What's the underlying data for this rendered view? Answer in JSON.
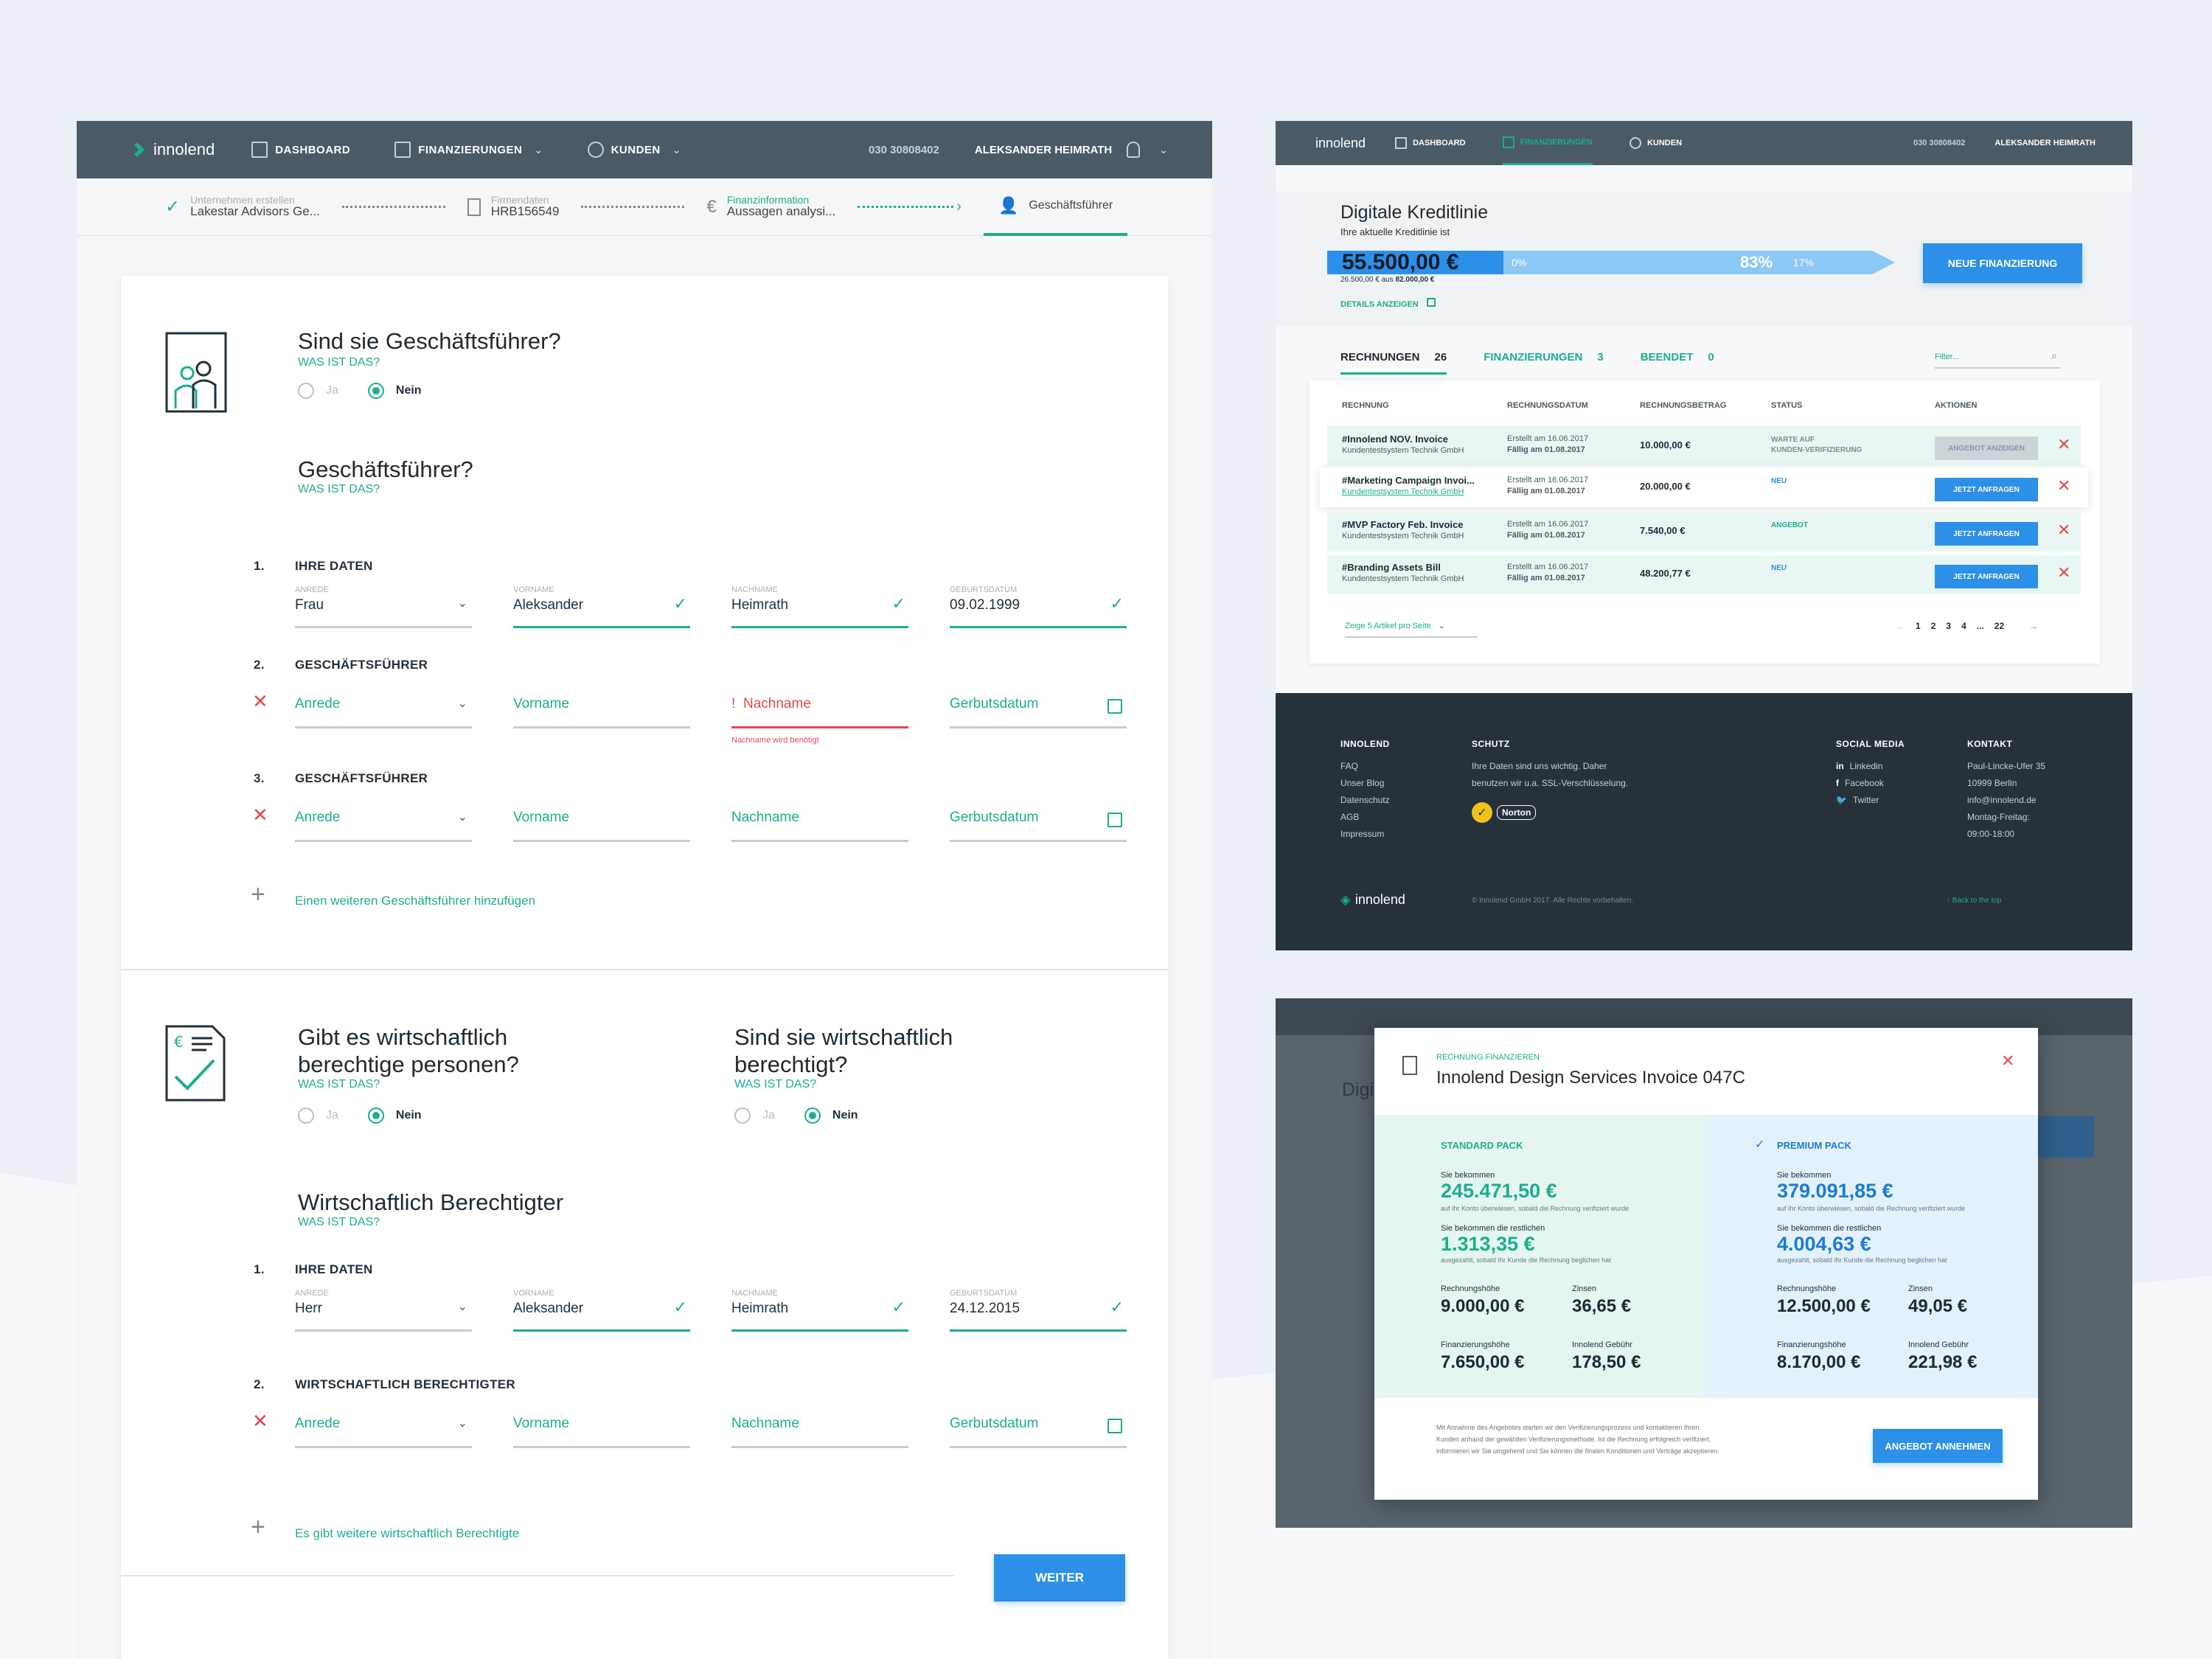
{
  "nav": {
    "logo": "innolend",
    "dashboard": "DASHBOARD",
    "finanzierungen": "FINANZIERUNGEN",
    "kunden": "KUNDEN",
    "phone": "030 30808402",
    "user": "ALEKSANDER HEIMRATH"
  },
  "steps": [
    {
      "small": "Unternehmen erstellen",
      "big": "Lakestar Advisors Ge..."
    },
    {
      "small": "Firmendaten",
      "big": "HRB156549"
    },
    {
      "small": "Finanzinformation",
      "big": "Aussagen analysi..."
    },
    {
      "small": "",
      "big": "Geschäftsführer"
    }
  ],
  "form": {
    "q1": {
      "title": "Sind sie Geschäftsführer?",
      "link": "WAS IST DAS?",
      "yes": "Ja",
      "no": "Nein"
    },
    "q2": {
      "title": "Geschäftsführer?",
      "link": "WAS IST DAS?"
    },
    "sec1": {
      "num": "1.",
      "label": "IHRE DATEN"
    },
    "f1": [
      {
        "label": "ANREDE",
        "value": "Frau"
      },
      {
        "label": "VORNAME",
        "value": "Aleksander"
      },
      {
        "label": "NACHNAME",
        "value": "Heimrath"
      },
      {
        "label": "GEBURTSDATUM",
        "value": "09.02.1999"
      }
    ],
    "sec2": {
      "num": "2.",
      "label": "GESCHÄFTSFÜHRER"
    },
    "sec3": {
      "num": "3.",
      "label": "GESCHÄFTSFÜHRER"
    },
    "placeholders": {
      "anrede": "Anrede",
      "vorname": "Vorname",
      "nachname": "Nachname",
      "geburt": "Gerbutsdatum"
    },
    "error": "Nachname wird benötigt",
    "add_gf": "Einen weiteren Geschäftsführer hinzufügen",
    "q3": {
      "title1": "Gibt es wirtschaftlich",
      "title2": "berechtige personen?",
      "link": "WAS IST DAS?",
      "yes": "Ja",
      "no": "Nein"
    },
    "q4": {
      "title1": "Sind sie wirtschaftlich",
      "title2": "berechtigt?",
      "link": "WAS IST DAS?",
      "yes": "Ja",
      "no": "Nein"
    },
    "q5": {
      "title": "Wirtschaftlich Berechtigter",
      "link": "WAS IST DAS?"
    },
    "sec4": {
      "num": "1.",
      "label": "IHRE DATEN"
    },
    "f2": [
      {
        "label": "ANREDE",
        "value": "Herr"
      },
      {
        "label": "VORNAME",
        "value": "Aleksander"
      },
      {
        "label": "NACHNAME",
        "value": "Heimrath"
      },
      {
        "label": "GEBURTSDATUM",
        "value": "24.12.2015"
      }
    ],
    "sec5": {
      "num": "2.",
      "label": "WIRTSCHAFTLICH BERECHTIGTER"
    },
    "add_wb": "Es gibt weitere wirtschaftlich Berechtigte",
    "weiter": "WEITER"
  },
  "kredit": {
    "title": "Digitale Kreditlinie",
    "subtitle": "Ihre aktuelle Kreditlinie ist",
    "amount": "55.500,00 €",
    "p0": "0%",
    "p83": "83%",
    "p17": "17%",
    "usage_used": "26.500,00 €",
    "usage_of": " aus ",
    "usage_total": "82.000,00 €",
    "details": "DETAILS ANZEIGEN",
    "new_btn": "NEUE FINANZIERUNG",
    "fill_percent": 31
  },
  "tabs": [
    {
      "label": "RECHNUNGEN",
      "count": "26"
    },
    {
      "label": "FINANZIERUNGEN",
      "count": "3"
    },
    {
      "label": "BEENDET",
      "count": "0"
    }
  ],
  "filter_placeholder": "Filter...",
  "table": {
    "headers": [
      "RECHNUNG",
      "RECHNUNGSDATUM",
      "RECHNUNGSBETRAG",
      "STATUS",
      "AKTIONEN"
    ],
    "rows": [
      {
        "name": "#Innolend NOV. Invoice",
        "sub": "Kundentestsystem Technik GmbH",
        "d1": "Erstellt am 16.06.2017",
        "d2": "Fällig am 01.08.2017",
        "amount": "10.000,00 €",
        "status1": "WARTE AUF",
        "status2": "KUNDEN-VERIFIZIERUNG",
        "action": "ANGEBOT ANZEIGEN"
      },
      {
        "name": "#Marketing Campaign Invoi...",
        "sub": "Kundentestsystem Technik GmbH",
        "d1": "Erstellt am 16.06.2017",
        "d2": "Fällig am 01.08.2017",
        "amount": "20.000,00 €",
        "status1": "NEU",
        "status2": "",
        "action": "JETZT ANFRAGEN"
      },
      {
        "name": "#MVP Factory Feb. Invoice",
        "sub": "Kundentestsystem Technik GmbH",
        "d1": "Erstellt am 16.06.2017",
        "d2": "Fällig am 01.08.2017",
        "amount": "7.540,00 €",
        "status1": "ANGEBOT",
        "status2": "",
        "action": "JETZT ANFRAGEN"
      },
      {
        "name": "#Branding Assets Bill",
        "sub": "Kundentestsystem Technik GmbH",
        "d1": "Erstellt am 16.06.2017",
        "d2": "Fällig am 01.08.2017",
        "amount": "48.200,77 €",
        "status1": "NEU",
        "status2": "",
        "action": "JETZT ANFRAGEN"
      }
    ],
    "per_page": "Zeige 5 Artikel pro Seite",
    "pages": [
      "1",
      "2",
      "3",
      "4",
      "...",
      "22"
    ]
  },
  "footer": {
    "innolend": {
      "h": "INNOLEND",
      "items": [
        "FAQ",
        "Unser Blog",
        "Datenschutz",
        "AGB",
        "Impressum"
      ]
    },
    "schutz": {
      "h": "SCHUTZ",
      "text1": "Ihre Daten sind uns wichtig. Daher",
      "text2": "benutzen wir u.a. SSL-Verschlüsselung.",
      "badge": "Norton"
    },
    "social": {
      "h": "SOCIAL MEDIA",
      "items": [
        "Linkedin",
        "Facebook",
        "Twitter"
      ]
    },
    "kontakt": {
      "h": "KONTAKT",
      "items": [
        "Paul-Lincke-Ufer 35",
        "10999 Berlin",
        "info@innolend.de",
        "Montag-Freitag:",
        "09:00-18:00"
      ]
    },
    "copyright": "© Innolend GmbH 2017. Alle Rechte vorbehalten.",
    "back": "Back to the top"
  },
  "modal": {
    "small": "RECHNUNG FINANZIEREN",
    "title": "Innolend Design Services Invoice 047C",
    "standard": {
      "name": "STANDARD PACK",
      "get_label": "Sie bekommen",
      "get": "245.471,50 €",
      "get_note": "auf Ihr Konto überwiesen, sobald die Rechnung verifiziert wurde",
      "rest_label": "Sie bekommen die restlichen",
      "rest": "1.313,35 €",
      "rest_note": "ausgezahlt, sobald Ihr Kunde die Rechnung beglichen hat",
      "rh_label": "Rechnungshöhe",
      "rh": "9.000,00 €",
      "zi_label": "Zinsen",
      "zi": "36,65 €",
      "fh_label": "Finanzierungshöhe",
      "fh": "7.650,00 €",
      "ig_label": "Innolend Gebühr",
      "ig": "178,50 €"
    },
    "premium": {
      "name": "PREMIUM PACK",
      "get_label": "Sie bekommen",
      "get": "379.091,85 €",
      "get_note": "auf Ihr Konto überwiesen, sobald die Rechnung verifiziert wurde",
      "rest_label": "Sie bekommen die restlichen",
      "rest": "4.004,63 €",
      "rest_note": "ausgezahlt, sobald Ihr Kunde die Rechnung beglichen hat",
      "rh_label": "Rechnungshöhe",
      "rh": "12.500,00 €",
      "zi_label": "Zinsen",
      "zi": "49,05 €",
      "fh_label": "Finanzierungshöhe",
      "fh": "8.170,00 €",
      "ig_label": "Innolend Gebühr",
      "ig": "221,98 €"
    },
    "note1": "Mit Annahme des Angebotes starten wir den Verifizierungsprozess und kontaktieren Ihren",
    "note2": "Kunden anhand der gewählten Verifizierungsmethode. Ist die Rechnung erfolgreich verifiziert,",
    "note3": "informieren wir Sie umgehend und Sie können die finalen Konditionen und Verträge akzeptieren.",
    "accept": "ANGEBOT ANNEHMEN"
  },
  "colors": {
    "accent": "#1cae8d",
    "primary": "#2c8fe8",
    "nav": "#4a5a66",
    "error": "#e7484f",
    "footer": "#26313a"
  }
}
